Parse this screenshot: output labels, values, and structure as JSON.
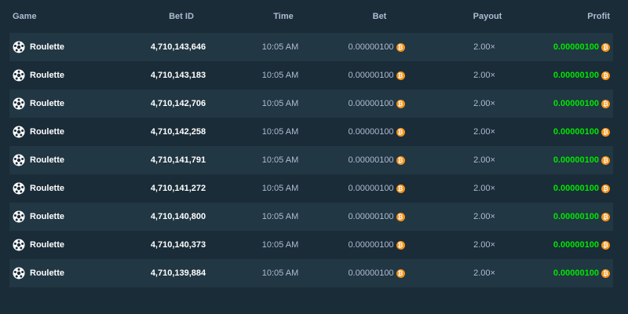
{
  "table": {
    "headers": {
      "game": "Game",
      "bet_id": "Bet ID",
      "time": "Time",
      "bet": "Bet",
      "payout": "Payout",
      "profit": "Profit"
    },
    "currency_icon": "bitcoin-icon",
    "game_icon": "roulette-wheel-icon",
    "colors": {
      "background": "#1a2c38",
      "row_alt": "#213743",
      "profit_green": "#00e701",
      "coin_orange": "#f7931a"
    },
    "rows": [
      {
        "game": "Roulette",
        "bet_id": "4,710,143,646",
        "time": "10:05 AM",
        "bet": "0.00000100",
        "payout": "2.00×",
        "profit": "0.00000100"
      },
      {
        "game": "Roulette",
        "bet_id": "4,710,143,183",
        "time": "10:05 AM",
        "bet": "0.00000100",
        "payout": "2.00×",
        "profit": "0.00000100"
      },
      {
        "game": "Roulette",
        "bet_id": "4,710,142,706",
        "time": "10:05 AM",
        "bet": "0.00000100",
        "payout": "2.00×",
        "profit": "0.00000100"
      },
      {
        "game": "Roulette",
        "bet_id": "4,710,142,258",
        "time": "10:05 AM",
        "bet": "0.00000100",
        "payout": "2.00×",
        "profit": "0.00000100"
      },
      {
        "game": "Roulette",
        "bet_id": "4,710,141,791",
        "time": "10:05 AM",
        "bet": "0.00000100",
        "payout": "2.00×",
        "profit": "0.00000100"
      },
      {
        "game": "Roulette",
        "bet_id": "4,710,141,272",
        "time": "10:05 AM",
        "bet": "0.00000100",
        "payout": "2.00×",
        "profit": "0.00000100"
      },
      {
        "game": "Roulette",
        "bet_id": "4,710,140,800",
        "time": "10:05 AM",
        "bet": "0.00000100",
        "payout": "2.00×",
        "profit": "0.00000100"
      },
      {
        "game": "Roulette",
        "bet_id": "4,710,140,373",
        "time": "10:05 AM",
        "bet": "0.00000100",
        "payout": "2.00×",
        "profit": "0.00000100"
      },
      {
        "game": "Roulette",
        "bet_id": "4,710,139,884",
        "time": "10:05 AM",
        "bet": "0.00000100",
        "payout": "2.00×",
        "profit": "0.00000100"
      }
    ]
  }
}
